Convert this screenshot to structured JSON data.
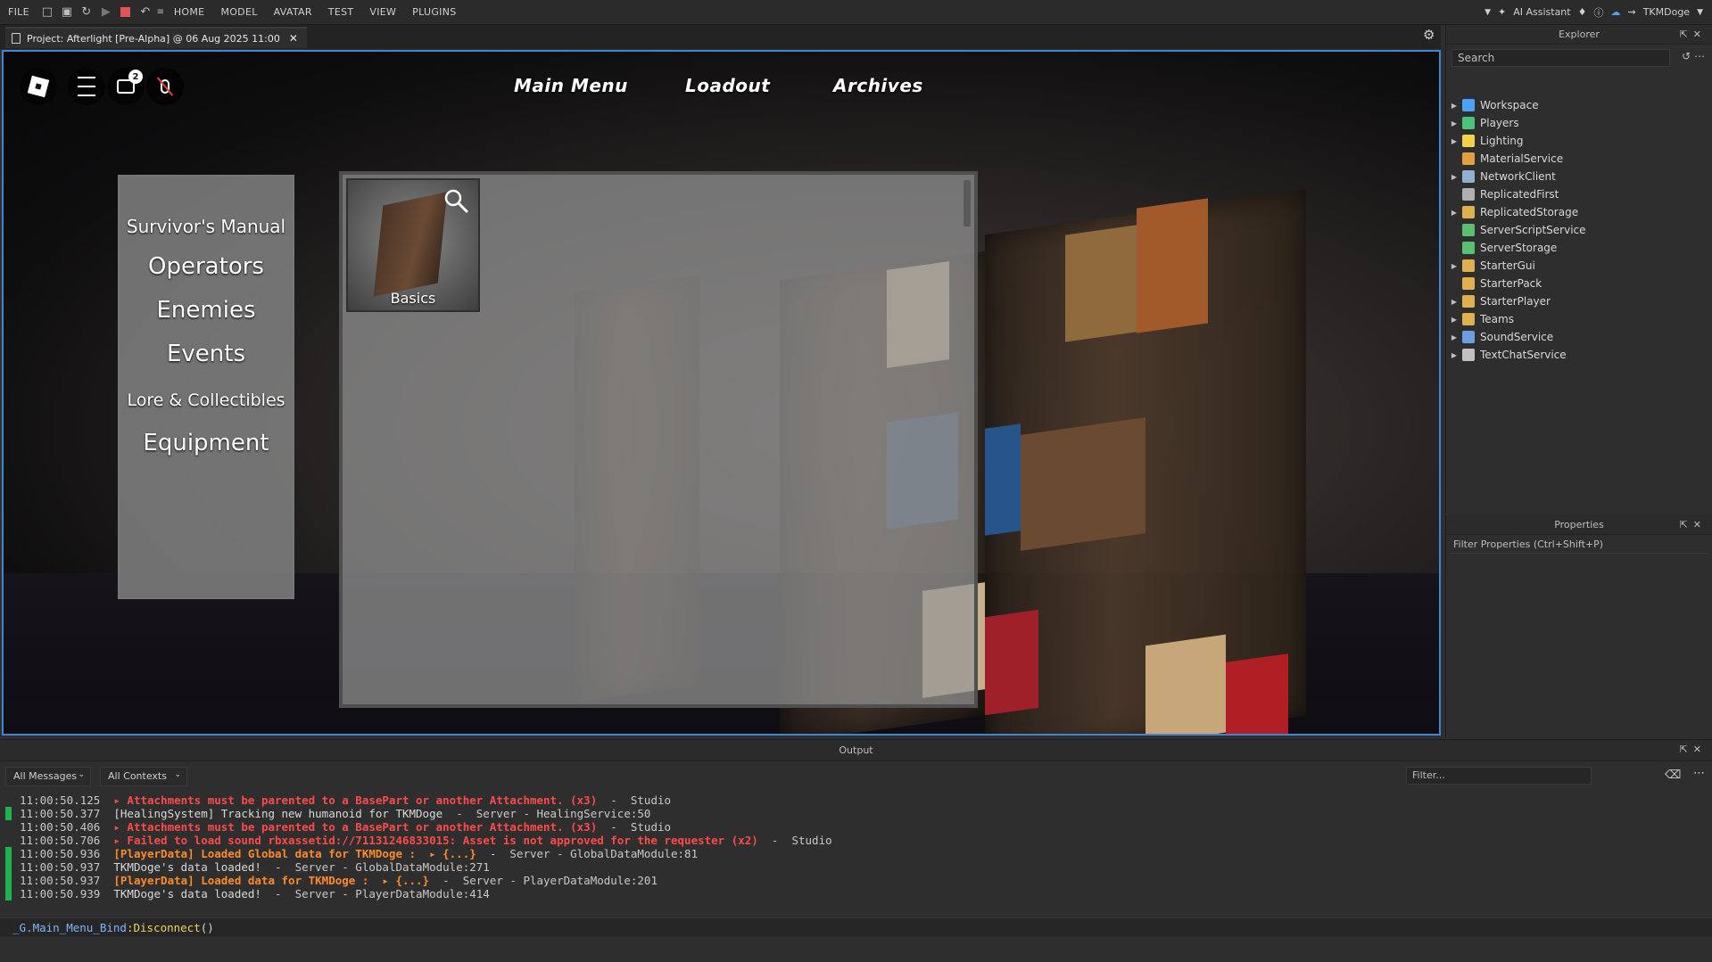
{
  "menubar": {
    "file": "FILE",
    "tabs": [
      "HOME",
      "MODEL",
      "AVATAR",
      "TEST",
      "VIEW",
      "PLUGINS"
    ],
    "ai_assistant": "AI Assistant",
    "username": "TKMDoge"
  },
  "doc_tab": {
    "title": "Project: Afterlight [Pre-Alpha] @ 06 Aug 2025 11:00"
  },
  "game": {
    "chat_badge": "2",
    "nav": [
      "Main Menu",
      "Loadout",
      "Archives"
    ],
    "manual": {
      "heading": "Survivor's Manual",
      "items": [
        "Operators",
        "Enemies",
        "Events",
        "Lore & Collectibles",
        "Equipment"
      ]
    },
    "cards": [
      {
        "label": "Basics",
        "icon": "search-icon"
      }
    ]
  },
  "explorer": {
    "title": "Explorer",
    "search_placeholder": "Search",
    "items": [
      {
        "label": "Workspace",
        "expandable": true,
        "icon_color": "#4aa3ff"
      },
      {
        "label": "Players",
        "expandable": true,
        "icon_color": "#4ac27a"
      },
      {
        "label": "Lighting",
        "expandable": true,
        "icon_color": "#f3d24a"
      },
      {
        "label": "MaterialService",
        "expandable": false,
        "icon_color": "#e0a040"
      },
      {
        "label": "NetworkClient",
        "expandable": true,
        "icon_color": "#8fb0d0"
      },
      {
        "label": "ReplicatedFirst",
        "expandable": false,
        "icon_color": "#b0b0b0"
      },
      {
        "label": "ReplicatedStorage",
        "expandable": true,
        "icon_color": "#e0b050"
      },
      {
        "label": "ServerScriptService",
        "expandable": false,
        "icon_color": "#5ac070"
      },
      {
        "label": "ServerStorage",
        "expandable": false,
        "icon_color": "#5ac070"
      },
      {
        "label": "StarterGui",
        "expandable": true,
        "icon_color": "#e0b050"
      },
      {
        "label": "StarterPack",
        "expandable": false,
        "icon_color": "#e0b050"
      },
      {
        "label": "StarterPlayer",
        "expandable": true,
        "icon_color": "#e0b050"
      },
      {
        "label": "Teams",
        "expandable": true,
        "icon_color": "#e0b050"
      },
      {
        "label": "SoundService",
        "expandable": true,
        "icon_color": "#6aa0e0"
      },
      {
        "label": "TextChatService",
        "expandable": true,
        "icon_color": "#c0c0c0"
      }
    ]
  },
  "properties": {
    "title": "Properties",
    "filter_placeholder": "Filter Properties (Ctrl+Shift+P)"
  },
  "output": {
    "title": "Output",
    "messages_dropdown": "All Messages",
    "contexts_dropdown": "All Contexts",
    "filter_placeholder": "Filter...",
    "lines": [
      {
        "time": "11:00:50.125",
        "text": "▸ Attachments must be parented to a BasePart or another Attachment. (x3)",
        "source": "  -  Studio",
        "level": "err",
        "bar": false
      },
      {
        "time": "11:00:50.377",
        "text": "[HealingSystem] Tracking new humanoid for TKMDoge",
        "source": "  -  Server - HealingService:50",
        "level": "info",
        "bar": true
      },
      {
        "time": "11:00:50.406",
        "text": "▸ Attachments must be parented to a BasePart or another Attachment. (x3)",
        "source": "  -  Studio",
        "level": "err",
        "bar": false
      },
      {
        "time": "11:00:50.706",
        "text": "▸ Failed to load sound rbxassetid://71131246833015: Asset is not approved for the requester (x2)",
        "source": "  -  Studio",
        "level": "err",
        "bar": false
      },
      {
        "time": "11:00:50.936",
        "text": "[PlayerData] Loaded Global data for TKMDoge :  ▸ {...}",
        "source": "  -  Server - GlobalDataModule:81",
        "level": "warn",
        "bar": true
      },
      {
        "time": "11:00:50.937",
        "text": "TKMDoge's data loaded!",
        "source": "  -  Server - GlobalDataModule:271",
        "level": "info",
        "bar": true
      },
      {
        "time": "11:00:50.937",
        "text": "[PlayerData] Loaded data for TKMDoge :  ▸ {...}",
        "source": "  -  Server - PlayerDataModule:201",
        "level": "warn",
        "bar": true
      },
      {
        "time": "11:00:50.939",
        "text": "TKMDoge's data loaded!",
        "source": "  -  Server - PlayerDataModule:414",
        "level": "info",
        "bar": true
      }
    ],
    "command": {
      "prefix": "_G.Main_Menu_Bind",
      "method": ":Disconnect",
      "suffix": "()"
    }
  }
}
